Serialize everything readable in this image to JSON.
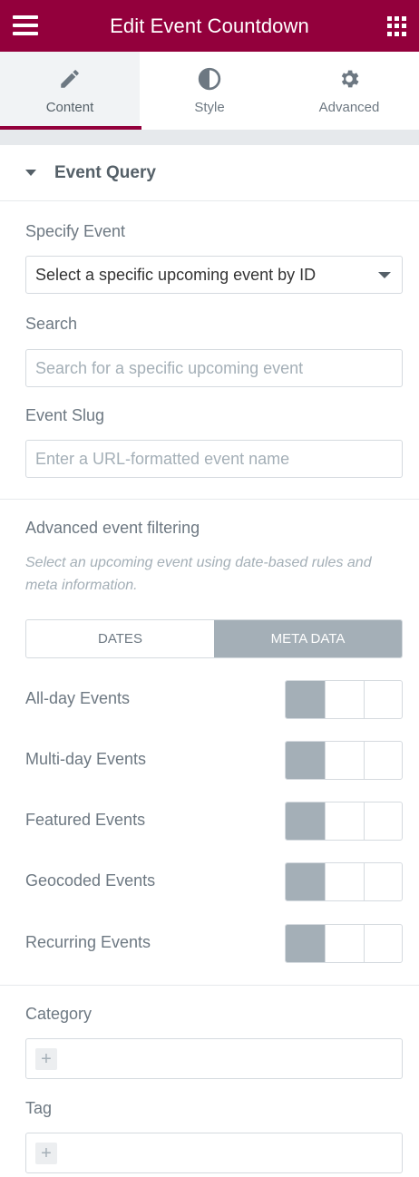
{
  "header": {
    "title": "Edit Event Countdown",
    "menu_icon": "hamburger-icon",
    "apps_icon": "grid-icon"
  },
  "tabs": [
    {
      "label": "Content",
      "icon": "pencil-icon",
      "active": true
    },
    {
      "label": "Style",
      "icon": "half-circle-icon",
      "active": false
    },
    {
      "label": "Advanced",
      "icon": "gear-icon",
      "active": false
    }
  ],
  "section": {
    "title": "Event Query"
  },
  "specify_event": {
    "label": "Specify Event",
    "value": "Select a specific upcoming event by ID"
  },
  "search": {
    "label": "Search",
    "placeholder": "Search for a specific upcoming event"
  },
  "event_slug": {
    "label": "Event Slug",
    "placeholder": "Enter a URL-formatted event name"
  },
  "advanced": {
    "label": "Advanced event filtering",
    "description": "Select an upcoming event using date-based rules and meta information.",
    "tabs": [
      "DATES",
      "META DATA"
    ],
    "active_tab": "META DATA"
  },
  "toggles": [
    {
      "label": "All-day Events"
    },
    {
      "label": "Multi-day Events"
    },
    {
      "label": "Featured Events"
    },
    {
      "label": "Geocoded Events"
    },
    {
      "label": "Recurring Events"
    }
  ],
  "category": {
    "label": "Category",
    "add": "+"
  },
  "tag": {
    "label": "Tag",
    "add": "+"
  },
  "colors": {
    "brand": "#93003c",
    "active_gray": "#a4afb7",
    "border": "#d5dadf"
  }
}
